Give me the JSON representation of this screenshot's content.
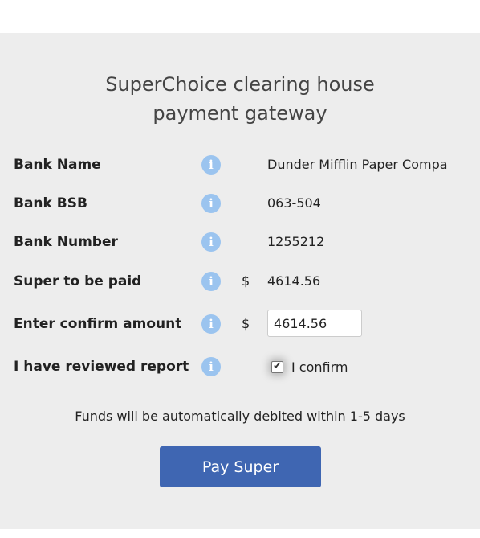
{
  "title": {
    "line1": "SuperChoice clearing house",
    "line2": "payment gateway"
  },
  "info_icon_glyph": "i",
  "fields": {
    "bank_name": {
      "label": "Bank Name",
      "value": "Dunder Mifflin Paper Compa"
    },
    "bank_bsb": {
      "label": "Bank BSB",
      "value": "063-504"
    },
    "bank_number": {
      "label": "Bank Number",
      "value": "1255212"
    },
    "super_to_be_paid": {
      "label": "Super to be paid",
      "currency": "$",
      "value": "4614.56"
    },
    "confirm_amount": {
      "label": "Enter confirm amount",
      "currency": "$",
      "input_value": "4614.56"
    },
    "reviewed_report": {
      "label": "I have reviewed report",
      "checkbox_checked": true,
      "checkbox_label": "I confirm"
    }
  },
  "note": "Funds will be automatically debited within 1-5 days",
  "pay_button_label": "Pay Super",
  "colors": {
    "panel_background": "#ededed",
    "info_icon": "#9bc4ef",
    "pay_button": "#3f66b2"
  },
  "icons": {
    "info": "info-icon",
    "checkmark": "checkmark-icon"
  }
}
